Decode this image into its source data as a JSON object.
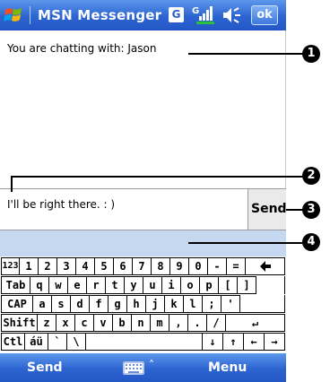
{
  "titlebar": {
    "title": "MSN Messenger",
    "gprs_label": "G",
    "ok_label": "ok"
  },
  "chat": {
    "header": "You are chatting with: Jason"
  },
  "composer": {
    "message_text": "I'll be right there. : )",
    "send_label": "Send"
  },
  "keyboard": {
    "rows": [
      [
        "123",
        "1",
        "2",
        "3",
        "4",
        "5",
        "6",
        "7",
        "8",
        "9",
        "0",
        "-",
        "=",
        "◆"
      ],
      [
        "Tab",
        "q",
        "w",
        "e",
        "r",
        "t",
        "y",
        "u",
        "i",
        "o",
        "p",
        "[",
        "]"
      ],
      [
        "CAP",
        "a",
        "s",
        "d",
        "f",
        "g",
        "h",
        "j",
        "k",
        "l",
        ";",
        "'"
      ],
      [
        "Shift",
        "z",
        "x",
        "c",
        "v",
        "b",
        "n",
        "m",
        ",",
        ".",
        "/",
        "↵"
      ],
      [
        "Ctl",
        "áü",
        "`",
        "\\",
        "",
        "↓",
        "↑",
        "←",
        "→"
      ]
    ]
  },
  "menubar": {
    "left_label": "Send",
    "right_label": "Menu",
    "input_arrow": "˄"
  },
  "callouts": [
    "1",
    "2",
    "3",
    "4"
  ],
  "colors": {
    "titlebar": "#2c64d0",
    "status_band": "#c5d8f0",
    "send_button_bg": "#eaeaea"
  }
}
